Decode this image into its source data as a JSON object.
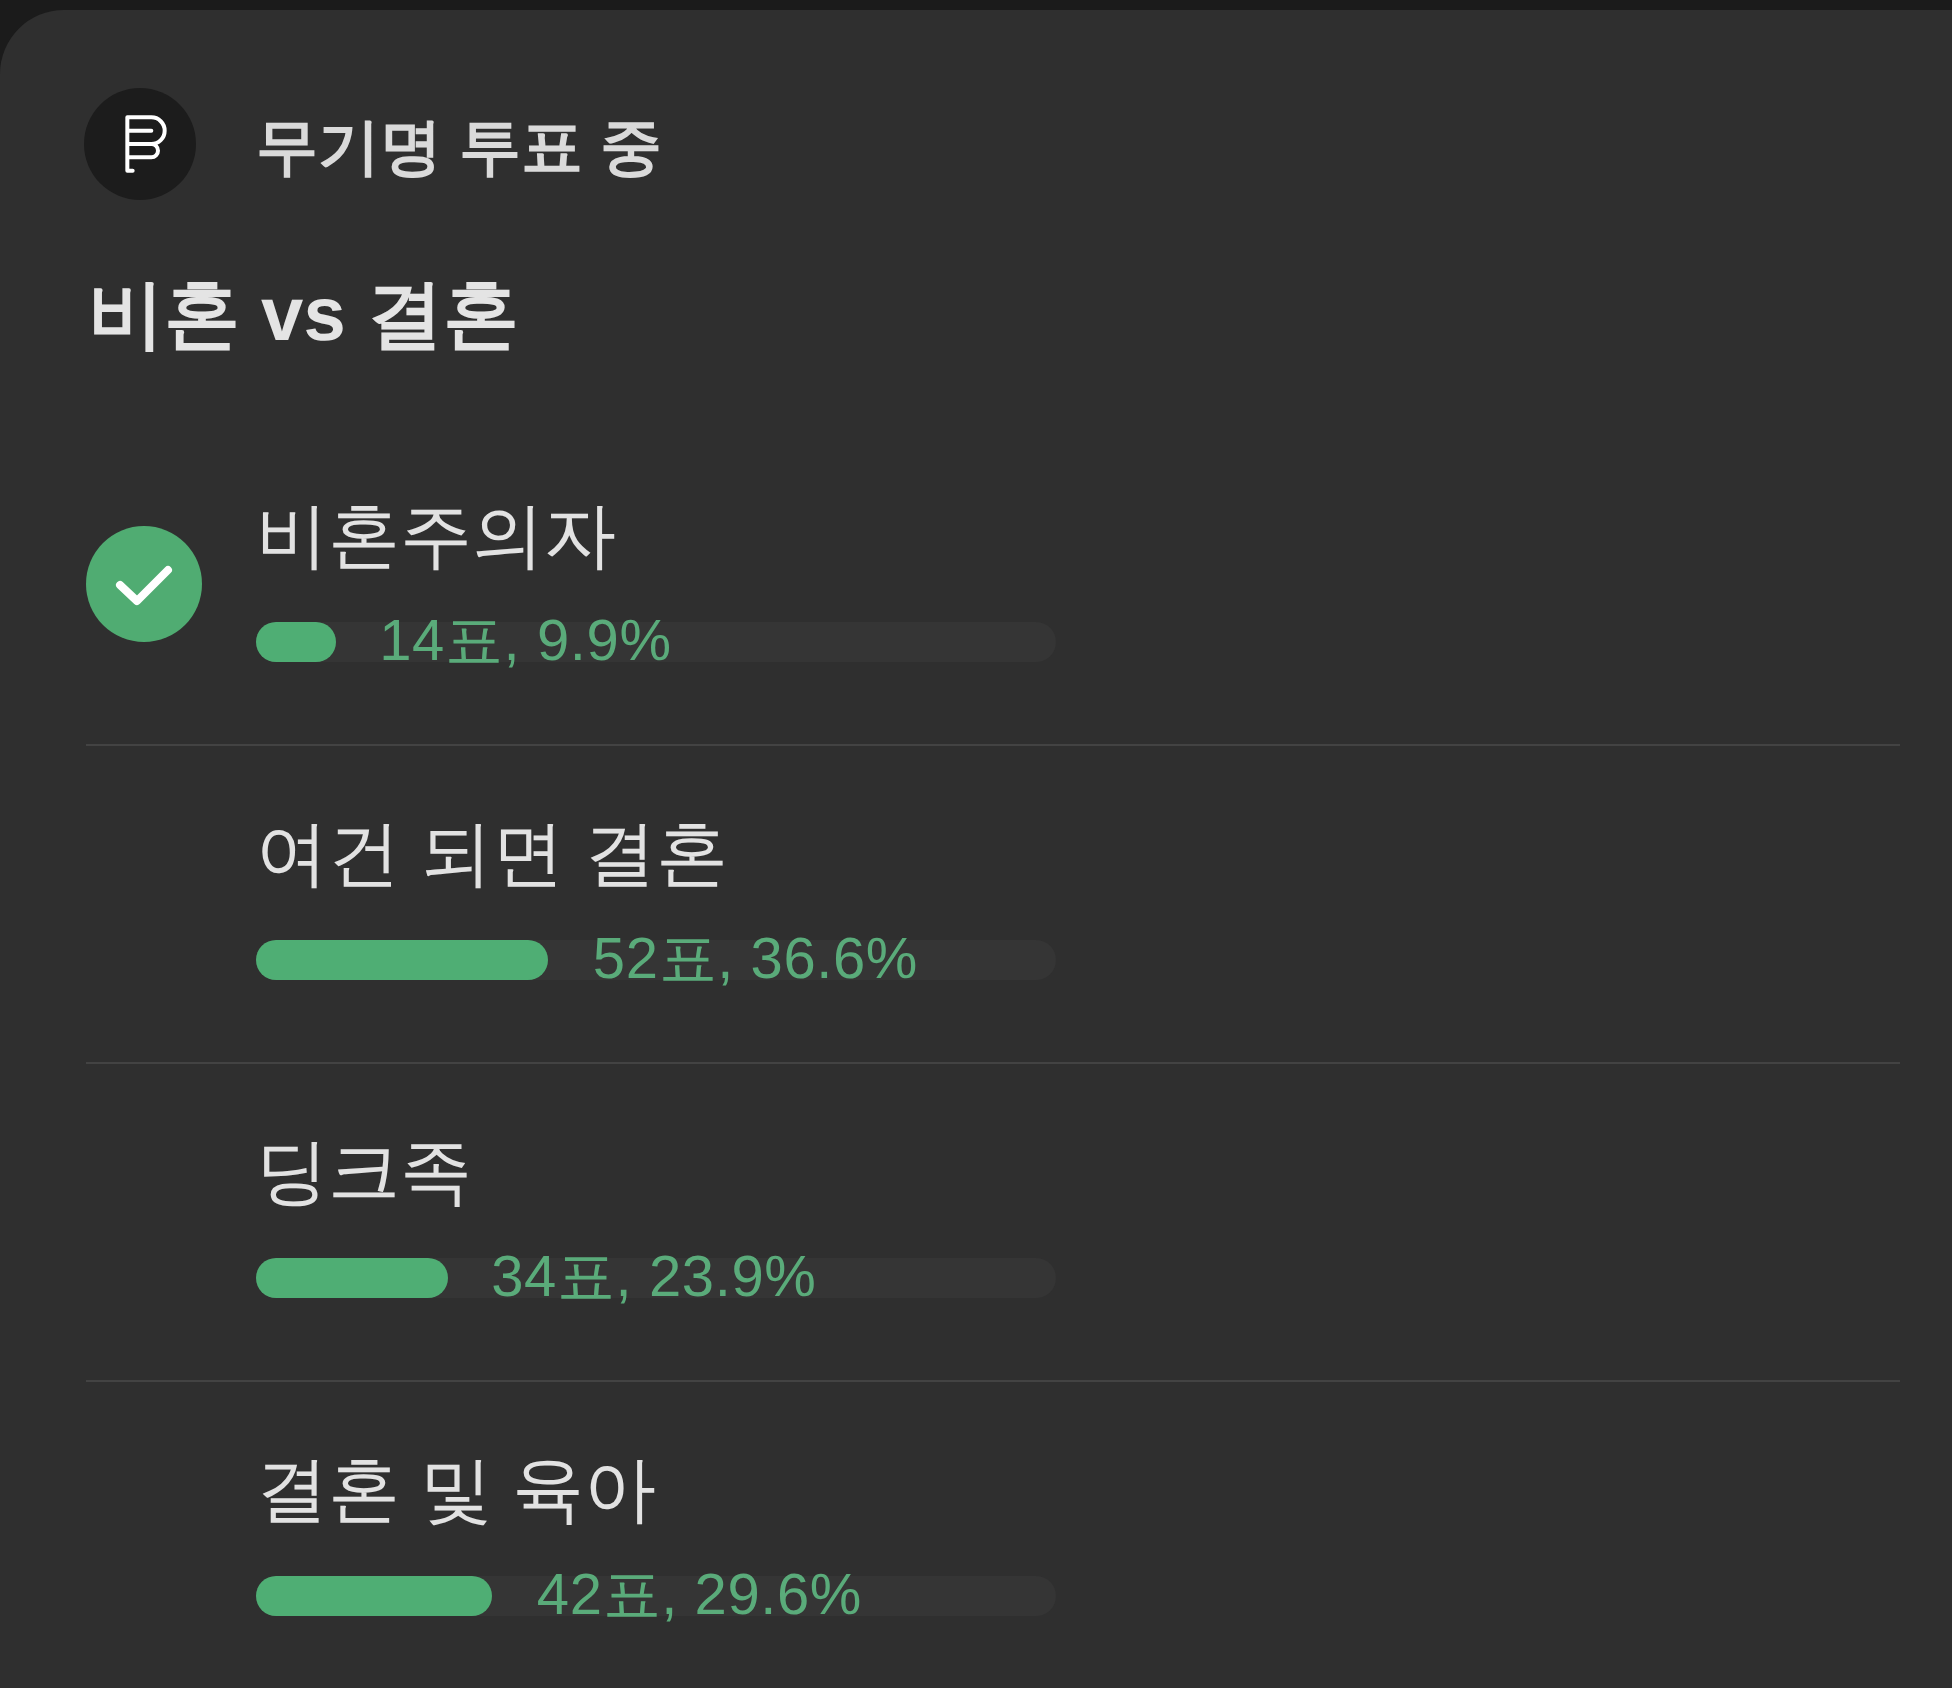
{
  "header": {
    "status": "무기명 투표 중"
  },
  "poll": {
    "title": "비혼 vs 결혼"
  },
  "options": [
    {
      "label": "비혼주의자",
      "selected": true,
      "level": 0.099,
      "result": "14표, 9.9%"
    },
    {
      "label": "여건 되면 결혼",
      "selected": false,
      "level": 0.366,
      "result": "52표, 36.6%"
    },
    {
      "label": "딩크족",
      "selected": false,
      "level": 0.239,
      "result": "34표, 23.9%"
    },
    {
      "label": "결혼 및 육아",
      "selected": false,
      "level": 0.296,
      "result": "42표, 29.6%"
    }
  ]
}
